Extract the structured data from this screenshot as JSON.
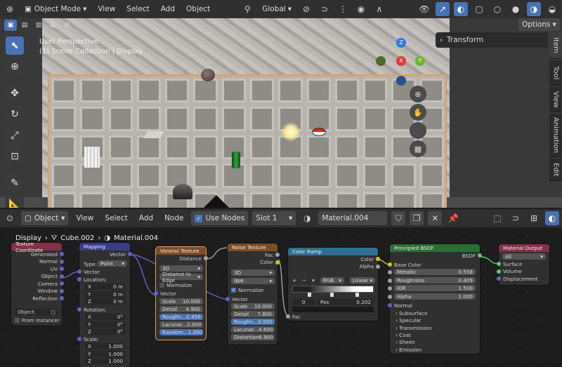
{
  "viewport_header": {
    "mode": "Object Mode",
    "menus": [
      "View",
      "Select",
      "Add",
      "Object"
    ],
    "transform": "Global"
  },
  "viewport": {
    "perspective": "User Perspective",
    "collection": "(1) Scene Collection | Display",
    "options": "Options",
    "transform_panel": "Transform",
    "side_tabs": [
      "Item",
      "Tool",
      "View",
      "Animation",
      "Edit"
    ],
    "gizmo": {
      "z": "Z",
      "x": "X",
      "y": "Y"
    }
  },
  "node_header": {
    "type": "Object",
    "menus": [
      "View",
      "Select",
      "Add",
      "Node"
    ],
    "use_nodes": "Use Nodes",
    "slot": "Slot 1",
    "material": "Material.004"
  },
  "breadcrumb": {
    "display": "Display",
    "object": "Cube.002",
    "material": "Material.004"
  },
  "nodes": {
    "texcoord": {
      "title": "Texture Coordinate",
      "outs": [
        "Generated",
        "Normal",
        "UV",
        "Object",
        "Camera",
        "Window",
        "Reflection"
      ],
      "object_label": "Object:",
      "from_instancer": "From Instancer"
    },
    "mapping": {
      "title": "Mapping",
      "vector_out": "Vector",
      "type_label": "Type:",
      "type": "Point",
      "vector_in": "Vector",
      "location": "Location:",
      "loc": [
        [
          "X",
          "0 m"
        ],
        [
          "Y",
          "0 m"
        ],
        [
          "Z",
          "0 m"
        ]
      ],
      "rotation": "Rotation:",
      "rot": [
        [
          "X",
          "0°"
        ],
        [
          "Y",
          "0°"
        ],
        [
          "Z",
          "0°"
        ]
      ],
      "scale": "Scale:",
      "scl": [
        [
          "X",
          "1.000"
        ],
        [
          "Y",
          "1.000"
        ],
        [
          "Z",
          "1.000"
        ]
      ]
    },
    "voronoi": {
      "title": "Voronoi Texture",
      "out": "Distance",
      "dim": "3D",
      "feature": "Distance to Edge",
      "normalize": "Normalize",
      "vector": "Vector",
      "fields": [
        [
          "Scale",
          "10.000"
        ],
        [
          "Detail",
          "4.900"
        ],
        [
          "Roughn...",
          "0.456"
        ],
        [
          "Lacunar...",
          "2.000"
        ],
        [
          "Random...",
          "1.000"
        ]
      ]
    },
    "noise": {
      "title": "Noise Texture",
      "outs": [
        "Fac",
        "Color"
      ],
      "dim": "3D",
      "type": "fBM",
      "normalize": "Normalize",
      "vector": "Vector",
      "fields": [
        [
          "Scale",
          "10.000"
        ],
        [
          "Detail",
          "7.800"
        ],
        [
          "Roughn...",
          "0.500"
        ],
        [
          "Lacunar...",
          "4.600"
        ],
        [
          "Distortion",
          "6.900"
        ]
      ]
    },
    "ramp": {
      "title": "Color Ramp",
      "outs": [
        "Color",
        "Alpha"
      ],
      "mode": "RGB",
      "interp": "Linear",
      "index": "0",
      "pos_label": "Pos",
      "pos": "0.202",
      "fac": "Fac"
    },
    "bsdf": {
      "title": "Principled BSDF",
      "out": "BSDF",
      "base_color": "Base Color",
      "fields": [
        [
          "Metallic",
          "0.558"
        ],
        [
          "Roughness",
          "0.409"
        ],
        [
          "IOR",
          "1.500"
        ],
        [
          "Alpha",
          "1.000"
        ]
      ],
      "normal": "Normal",
      "panels": [
        "Subsurface",
        "Specular",
        "Transmission",
        "Coat",
        "Sheen",
        "Emission"
      ]
    },
    "output": {
      "title": "Material Output",
      "target": "All",
      "ins": [
        "Surface",
        "Volume",
        "Displacement"
      ]
    }
  },
  "colors": {
    "accent": "#4772b3",
    "selection": "#e0a055"
  }
}
